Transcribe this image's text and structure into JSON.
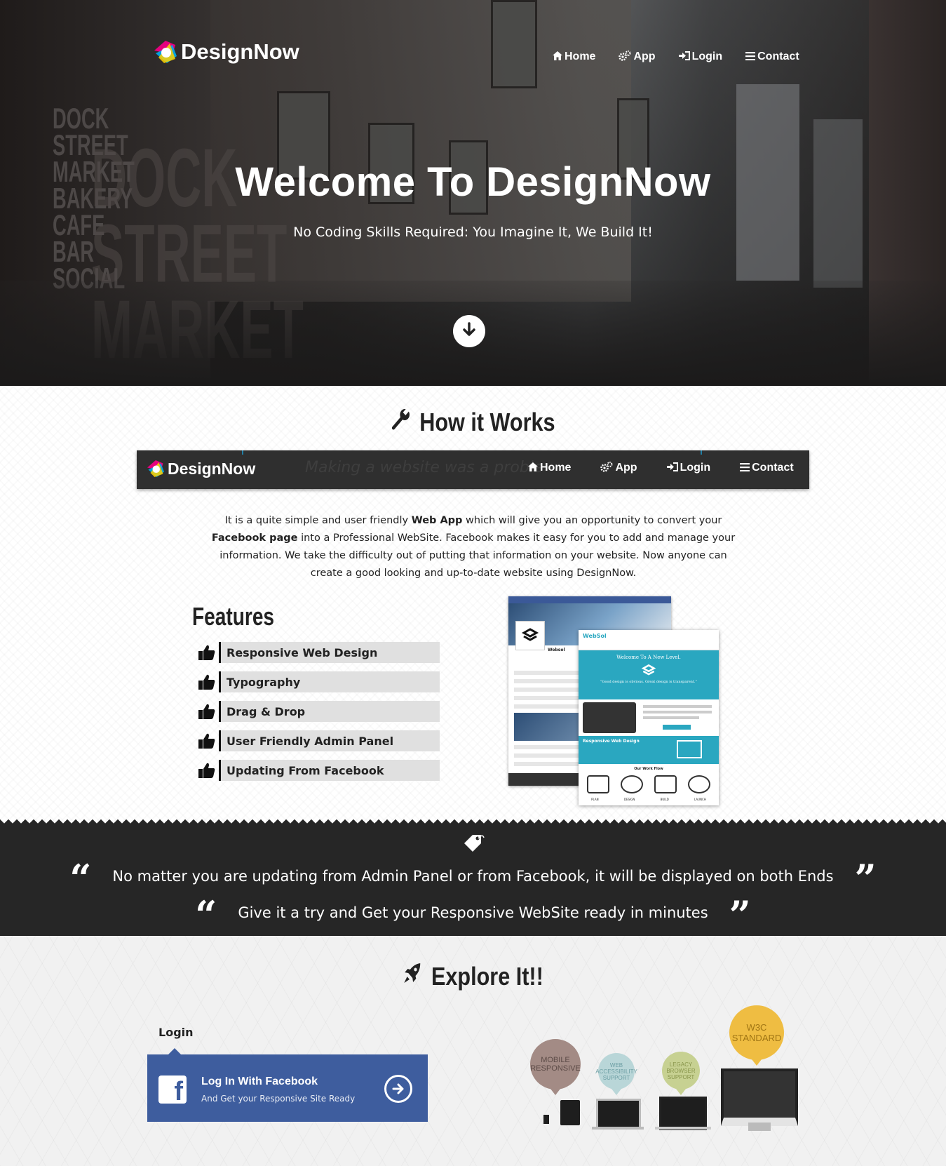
{
  "brand": {
    "name": "DesignNow"
  },
  "nav": [
    {
      "label": "Home",
      "icon": "home-icon"
    },
    {
      "label": "App",
      "icon": "gears-icon"
    },
    {
      "label": "Login",
      "icon": "sign-in-icon"
    },
    {
      "label": "Contact",
      "icon": "list-icon"
    }
  ],
  "hero": {
    "title": "Welcome To DesignNow",
    "tagline": "No Coding Skills Required: You Imagine It, We Build It!",
    "background_sign": "DOCK STREET MARKET BAKERY CAFE BAR SOCIAL",
    "background_sign_large": "DOCK STREET MARKET"
  },
  "how": {
    "title": "How it Works",
    "ghost_text": "Making a website was a proble",
    "intro_parts": [
      "It is a quite simple and user friendly ",
      "Web App",
      " which will give you an opportunity to convert your ",
      "Facebook page",
      " into a Professional WebSite. Facebook makes it easy for you to add and manage your information. We take the difficulty out of putting that information on your website. Now anyone can create a good looking and up-to-date website using DesignNow."
    ]
  },
  "features": {
    "title": "Features",
    "items": [
      "Responsive Web Design",
      "Typography",
      "Drag & Drop",
      "User Friendly Admin Panel",
      "Updating From Facebook"
    ]
  },
  "mockup": {
    "fb_page_name": "Websol",
    "site_brand": "WebSol",
    "site_headline": "Welcome To A New Level.",
    "site_quote": "\"Good design is obvious. Great design is transparent.\"",
    "section_label": "Responsive Web Design",
    "workflow_title": "Our Work Flow",
    "workflow_steps": [
      "PLAN",
      "DESIGN",
      "BUILD",
      "LAUNCH"
    ]
  },
  "quote": {
    "line1": "No matter you are updating from Admin Panel or from Facebook, it will be displayed on both Ends",
    "line2": "Give it a try and Get your Responsive WebSite ready in minutes",
    "open_mark": "“",
    "close_mark": "”"
  },
  "explore": {
    "title": "Explore It!!",
    "login_label": "Login",
    "fb_button_title": "Log In With Facebook",
    "fb_button_subtitle": "And Get your Responsive Site Ready",
    "fb_letter": "f",
    "bubbles": [
      "MOBILE RESPONSIVE",
      "WEB ACCESSIBILITY SUPPORT",
      "LEGACY BROWSER SUPPORT",
      "W3C STANDARD"
    ]
  },
  "colors": {
    "dark_band": "#262626",
    "facebook_blue": "#3e5d9e",
    "feature_bar": "#e0e0e0",
    "bubble_mobile": "#a38b85",
    "bubble_accessibility": "#b9d6d8",
    "bubble_legacy": "#c7d192",
    "bubble_w3c": "#efbd42"
  }
}
